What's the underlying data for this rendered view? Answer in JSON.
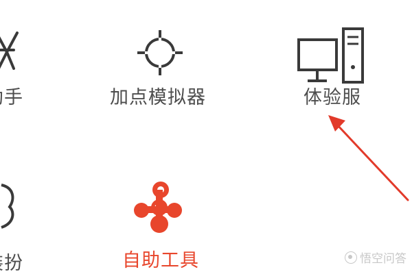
{
  "tools": [
    {
      "label": "助手",
      "icon": "star-icon"
    },
    {
      "label": "加点模拟器",
      "icon": "crosshair-icon"
    },
    {
      "label": "体验服",
      "icon": "monitor-tower-icon"
    },
    {
      "label": "装扮",
      "icon": "character-icon"
    },
    {
      "label": "自助工具",
      "icon": "molecule-icon"
    }
  ],
  "colors": {
    "icon": "#3a3a3a",
    "label": "#4d4d4d",
    "active": "#e8462c",
    "arrow": "#e23a2a"
  },
  "watermark": {
    "text": "悟空问答"
  }
}
